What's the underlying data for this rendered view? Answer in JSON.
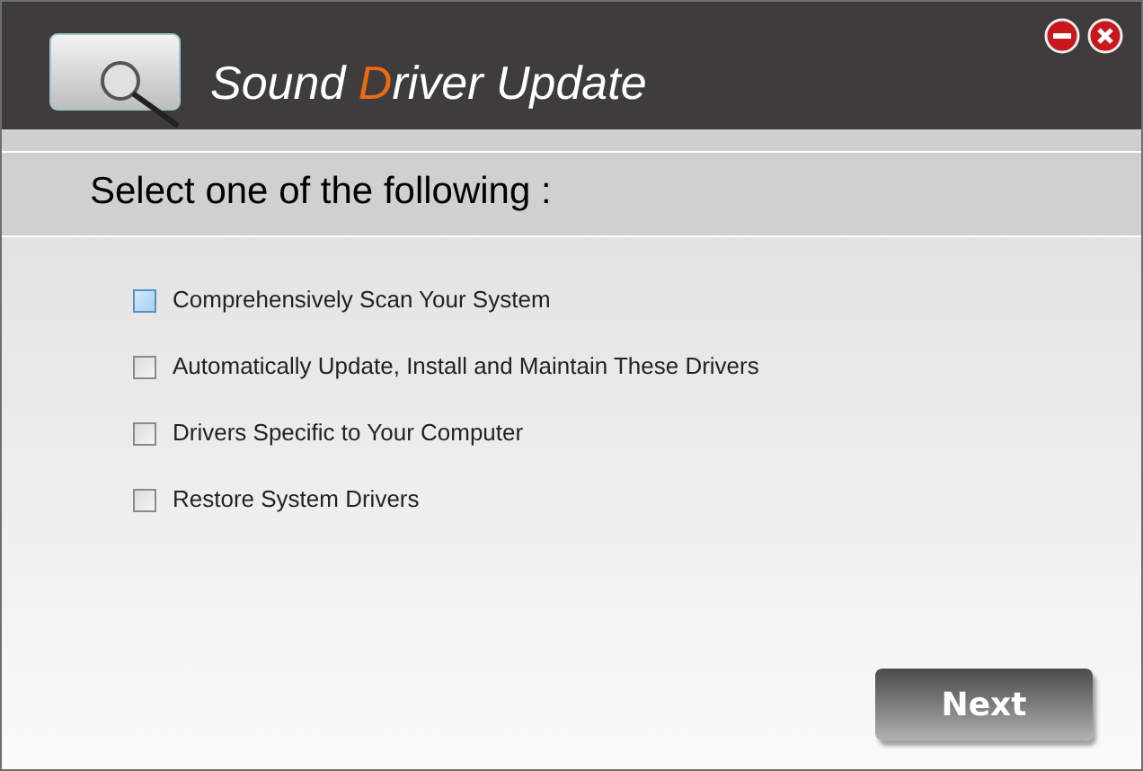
{
  "window": {
    "title_parts": [
      {
        "text": "Sound ",
        "accent": false
      },
      {
        "text": "D",
        "accent": true
      },
      {
        "text": "river Update",
        "accent": false
      }
    ]
  },
  "prompt": "Select one of the following :",
  "options": [
    {
      "label": "Comprehensively Scan Your System",
      "checked": false,
      "focused": true
    },
    {
      "label": "Automatically Update, Install and Maintain These Drivers",
      "checked": false,
      "focused": false
    },
    {
      "label": "Drivers Specific to Your Computer",
      "checked": false,
      "focused": false
    },
    {
      "label": "Restore System Drivers",
      "checked": false,
      "focused": false
    }
  ],
  "buttons": {
    "next": "Next"
  }
}
